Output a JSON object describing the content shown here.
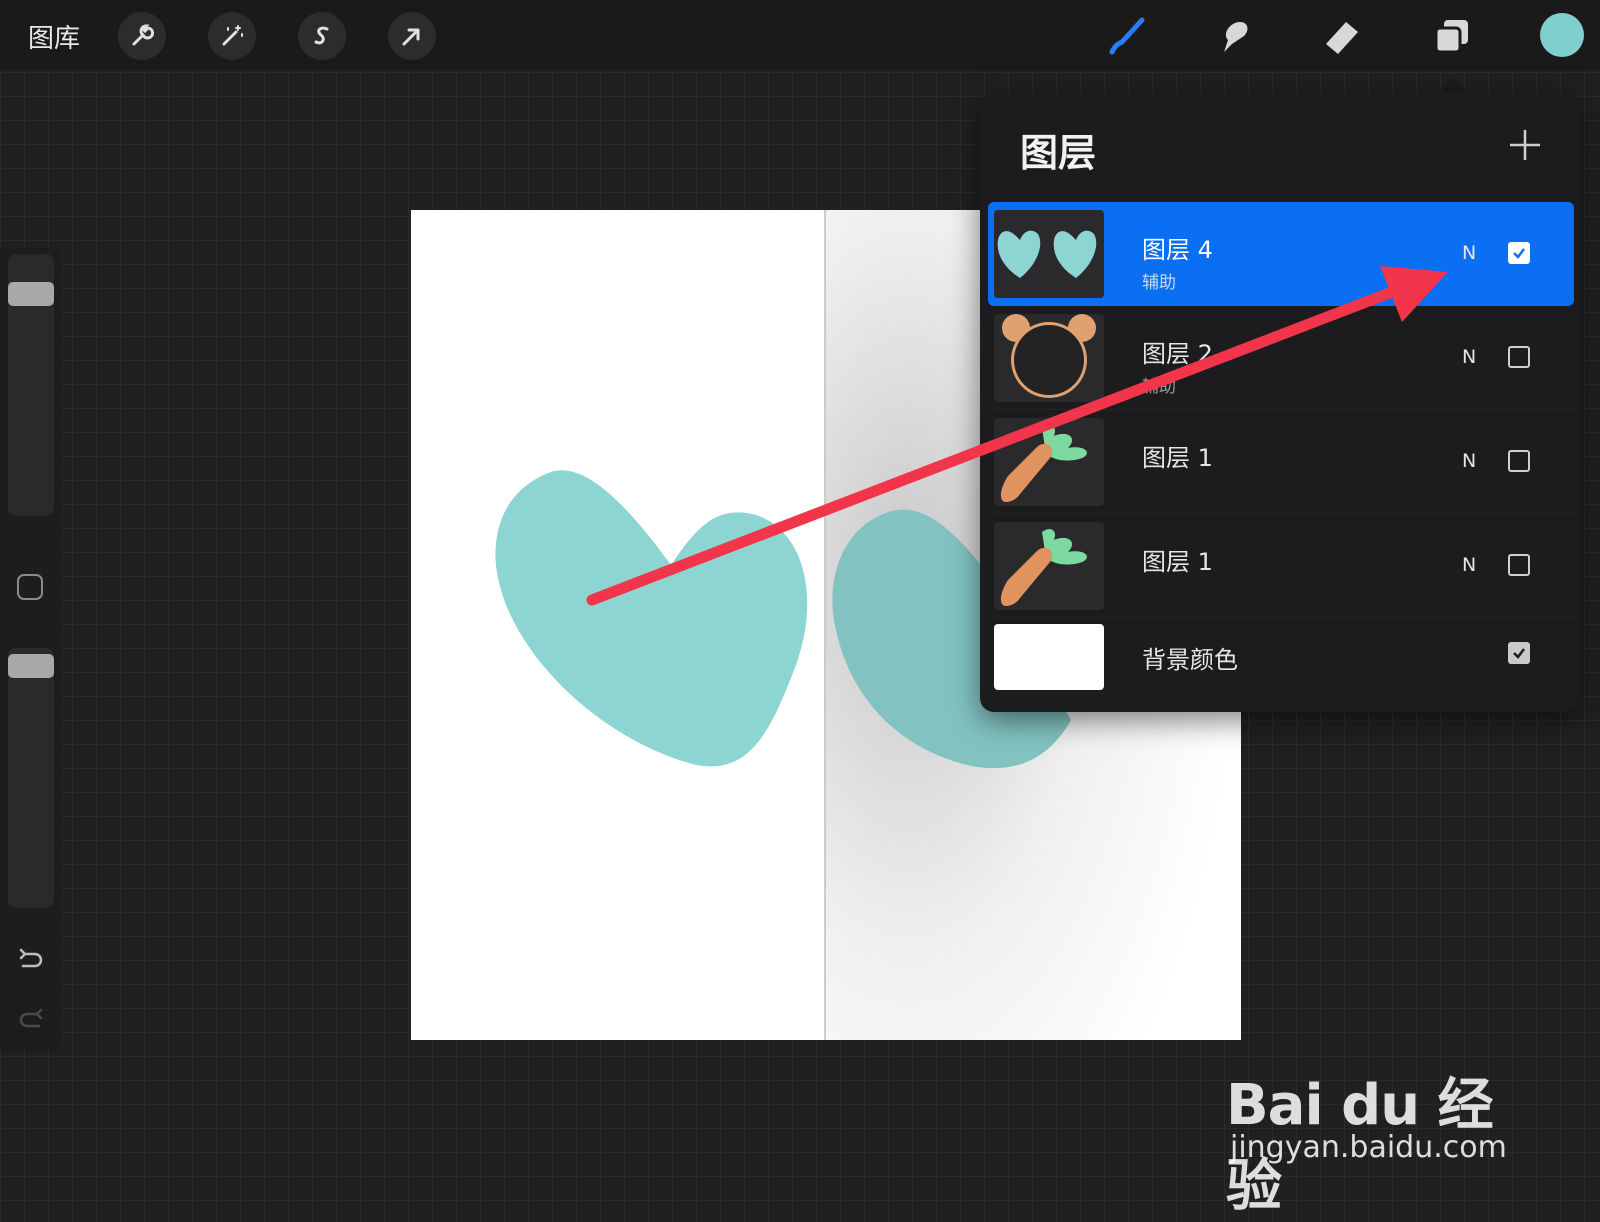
{
  "toolbar": {
    "gallery_label": "图库",
    "tools_left": [
      "wrench-icon",
      "magic-wand-icon",
      "selection-s-icon",
      "transform-arrow-icon"
    ],
    "tools_right": [
      "brush-icon",
      "smudge-icon",
      "eraser-icon",
      "layers-icon"
    ],
    "active_tool": "brush-icon",
    "current_color": "#7fcfcc"
  },
  "sidebar": {
    "brush_size_level": 0.95,
    "opacity_level": 0.95
  },
  "layers_panel": {
    "title": "图层",
    "layers": [
      {
        "name": "图层 4",
        "sub": "辅助",
        "blend": "N",
        "visible": true,
        "selected": true,
        "thumb": "two-hearts"
      },
      {
        "name": "图层 2",
        "sub": "辅助",
        "blend": "N",
        "visible": false,
        "selected": false,
        "thumb": "bear-face"
      },
      {
        "name": "图层 1",
        "sub": "",
        "blend": "N",
        "visible": false,
        "selected": false,
        "thumb": "carrot"
      },
      {
        "name": "图层 1",
        "sub": "",
        "blend": "N",
        "visible": false,
        "selected": false,
        "thumb": "carrot"
      },
      {
        "name": "背景颜色",
        "sub": "",
        "blend": "",
        "visible": true,
        "selected": false,
        "thumb": "white"
      }
    ]
  },
  "watermark": {
    "brand": "Bai du 经验",
    "url": "jingyan.baidu.com"
  },
  "colors": {
    "accent": "#0a6ff2",
    "heart": "#8dd5d3",
    "annotation_arrow": "#f2354a",
    "carrot": "#e0925f",
    "leaf": "#7dd9a0"
  }
}
